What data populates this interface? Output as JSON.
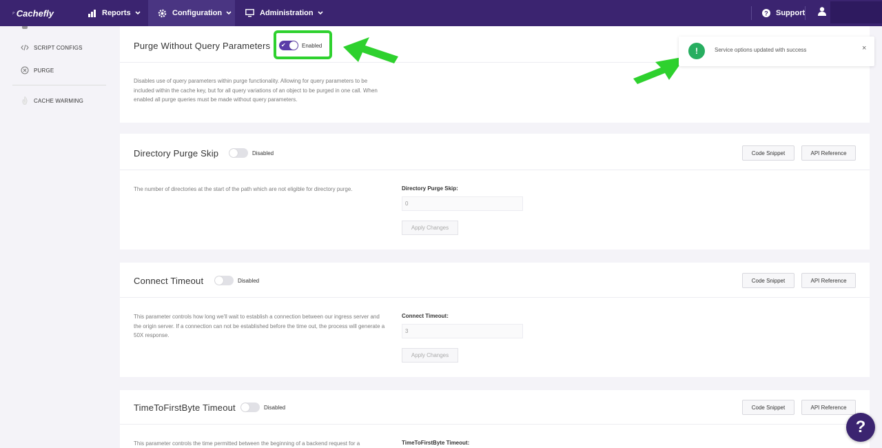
{
  "nav": {
    "logo_text": "Cachefly",
    "reports_label": "Reports",
    "configuration_label": "Configuration",
    "administration_label": "Administration",
    "support_label": "Support",
    "accent_color": "#3b2470"
  },
  "sidebar": {
    "items": [
      {
        "label": "SCRIPT CONFIGS",
        "icon": "code-icon"
      },
      {
        "label": "PURGE",
        "icon": "x-circle-icon"
      },
      {
        "label": "CACHE WARMING",
        "icon": "flame-icon"
      }
    ]
  },
  "cards": [
    {
      "title": "Purge Without Query Parameters",
      "toggle_state": "Enabled",
      "description": "Disables use of query parameters within purge functionality. Allowing for query parameters to be included within the cache key, but for all query variations of an object to be purged in one call. When enabled all purge queries must be made without query parameters."
    },
    {
      "title": "Directory Purge Skip",
      "toggle_state": "Disabled",
      "code_snippet_label": "Code Snippet",
      "api_reference_label": "API Reference",
      "description": "The number of directories at the start of the path which are not eligible for directory purge.",
      "field_label": "Directory Purge Skip:",
      "field_value": "0",
      "apply_label": "Apply Changes"
    },
    {
      "title": "Connect Timeout",
      "toggle_state": "Disabled",
      "code_snippet_label": "Code Snippet",
      "api_reference_label": "API Reference",
      "description": "This parameter controls how long we'll wait to establish a connection between our ingress server and the origin server. If a connection can not be established before the time out, the process will generate a 50X response.",
      "field_label": "Connect Timeout:",
      "field_value": "3",
      "apply_label": "Apply Changes"
    },
    {
      "title": "TimeToFirstByte Timeout",
      "toggle_state": "Disabled",
      "code_snippet_label": "Code Snippet",
      "api_reference_label": "API Reference",
      "description": "This parameter controls the time permitted between the beginning of a backend request for a",
      "field_label": "TimeToFirstByte Timeout:"
    }
  ],
  "toast": {
    "message": "Service options updated with success",
    "close": "×",
    "icon": "!"
  },
  "help": {
    "label": "?"
  }
}
